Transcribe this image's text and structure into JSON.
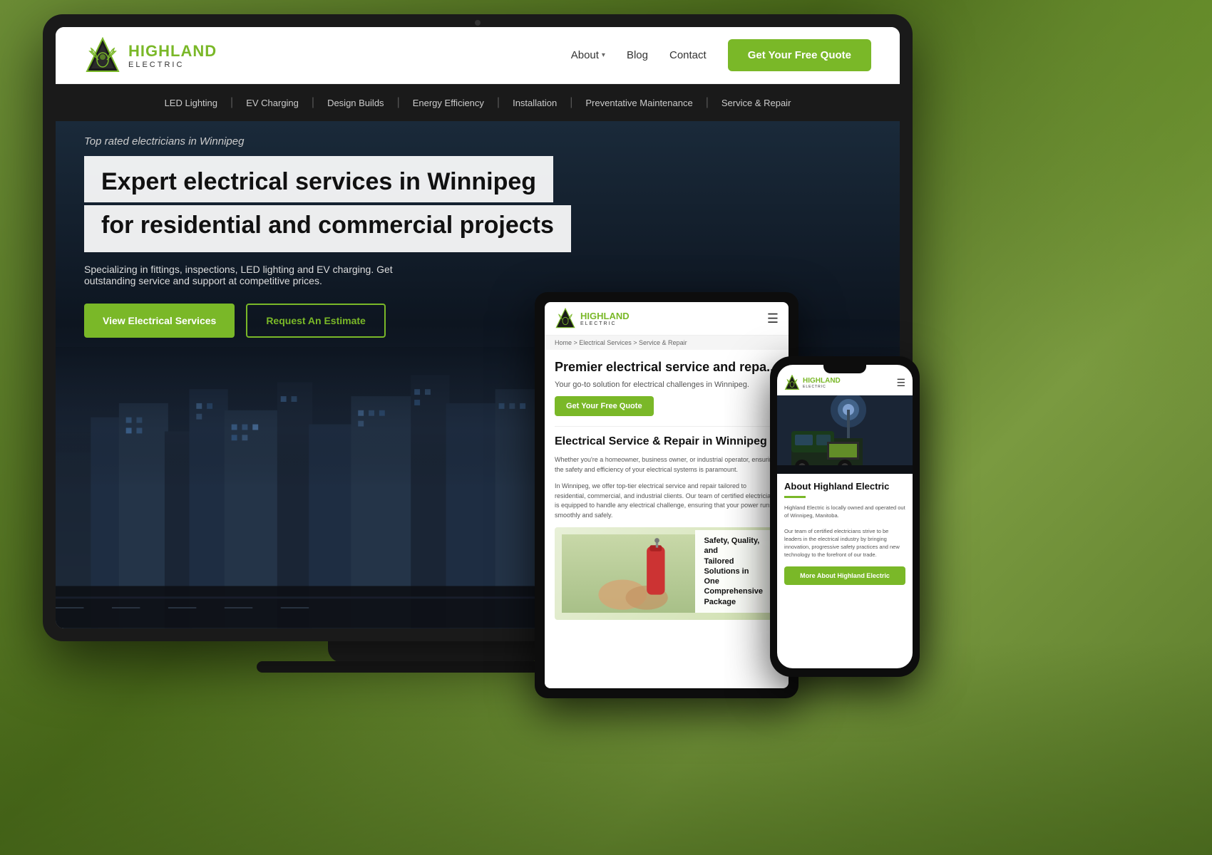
{
  "bg": {
    "color": "#5a7a2a"
  },
  "website": {
    "logo": {
      "brand": "HIGHLAND",
      "sub": "ELECTRIC",
      "icon_alt": "highland-electric-logo"
    },
    "nav": {
      "about_label": "About",
      "blog_label": "Blog",
      "contact_label": "Contact",
      "cta_label": "Get Your Free Quote"
    },
    "services_bar": {
      "items": [
        "LED Lighting",
        "EV Charging",
        "Design Builds",
        "Energy Efficiency",
        "Installation",
        "Preventative Maintenance",
        "Service & Repair"
      ]
    },
    "hero": {
      "tagline": "Top rated electricians in Winnipeg",
      "title_line1": "Expert electrical services in Winnipeg",
      "title_line2": "for residential and commercial projects",
      "subtitle": "Specializing in fittings, inspections, LED lighting and EV charging. Get outstanding service and support at competitive prices.",
      "btn_primary": "View Electrical Services",
      "btn_secondary": "Request An Estimate"
    }
  },
  "tablet": {
    "logo": {
      "brand": "HIGHLAND",
      "sub": "ELECTRIC"
    },
    "breadcrumb": "Home  >  Electrical Services  >  Service & Repair",
    "heading": "Premier electrical service and repa...",
    "sub": "Your go-to solution for electrical challenges in Winnipeg.",
    "cta": "Get Your Free Quote",
    "section_title": "Electrical Service & Repair in Winnipeg",
    "body1": "Whether you're a homeowner, business owner, or industrial operator, ensuring the safety and efficiency of your electrical systems is paramount.",
    "body2": "In Winnipeg, we offer top-tier electrical service and repair tailored to residential, commercial, and industrial clients. Our team of certified electricians is equipped to handle any electrical challenge, ensuring that your power runs smoothly and safely.",
    "img_text_line1": "Safety, Quality, and",
    "img_text_line2": "Tailored Solutions in",
    "img_text_line3": "One Comprehensive",
    "img_text_line4": "Package"
  },
  "phone": {
    "logo": {
      "brand": "HIGHLAND",
      "sub": "ELECTRIC"
    },
    "section_title": "About Highland Electric",
    "body1": "Highland Electric is locally owned and operated out of Winnipeg, Manitoba.",
    "body2": "Our team of certified electricians strive to be leaders in the electrical industry by bringing innovation, progressive safety practices and new technology to the forefront of our trade.",
    "cta": "More About Highland Electric"
  }
}
